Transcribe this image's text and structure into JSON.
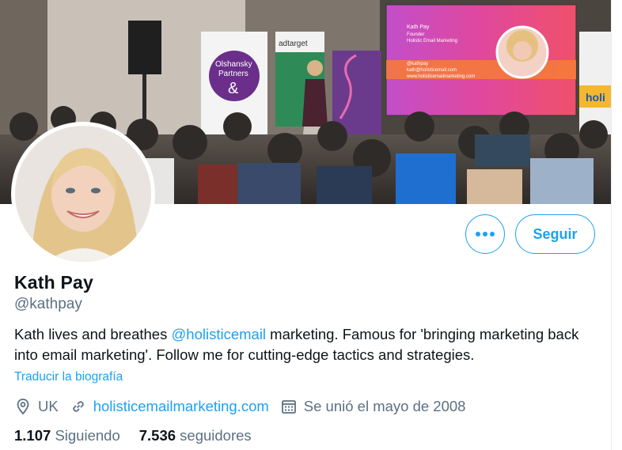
{
  "profile": {
    "name": "Kath Pay",
    "handle": "@kathpay",
    "bio_part1": "Kath lives and breathes ",
    "bio_mention": "@holisticemail",
    "bio_part2": " marketing. Famous for 'bringing marketing back into email marketing'. Follow me for cutting-edge tactics and strategies.",
    "translate_label": "Traducir la biografía",
    "location": "UK",
    "website": "holisticemailmarketing.com",
    "joined": "Se unió el mayo de 2008",
    "following_count": "1.107",
    "following_label": "Siguiendo",
    "followers_count": "7.536",
    "followers_label": "seguidores"
  },
  "actions": {
    "follow_label": "Seguir",
    "more_icon": "more-horizontal-icon"
  },
  "banner": {
    "screen_lines": [
      "Kath Pay",
      "Founder",
      "Holistic Email Marketing",
      "@kathpay",
      "kath@holisticemail.com",
      "www.holisticemailmarketing.com"
    ],
    "poster_left": "Olshansky Partners &",
    "poster_middle": "adtarget",
    "poster_right": "holi"
  },
  "colors": {
    "accent": "#1da1f2",
    "text_primary": "#0f1419",
    "text_secondary": "#5b7083"
  },
  "icons": {
    "location": "location-pin-icon",
    "link": "link-icon",
    "calendar": "calendar-icon"
  }
}
